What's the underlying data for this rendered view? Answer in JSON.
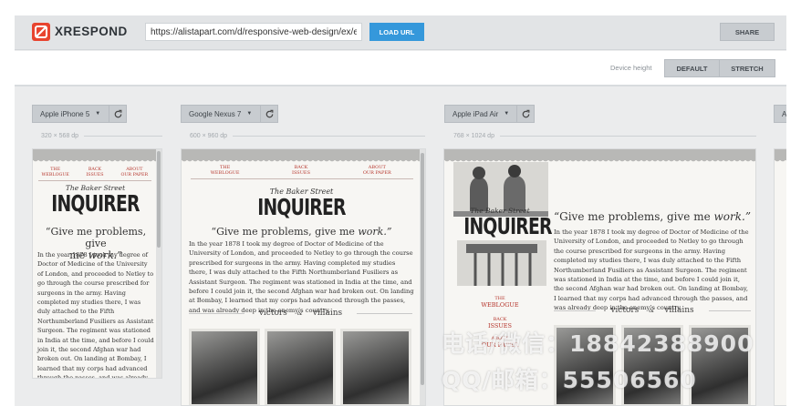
{
  "app": {
    "name": "XRESPOND",
    "url_value": "https://alistapart.com/d/responsive-web-design/ex/ex-site-flexible.html",
    "load_label": "LOAD URL",
    "share_label": "SHARE",
    "device_height_label": "Device height",
    "default_label": "DEFAULT",
    "stretch_label": "STRETCH"
  },
  "devices": [
    {
      "name": "Apple iPhone 5",
      "dims": "320 × 568 dp"
    },
    {
      "name": "Google Nexus 7",
      "dims": "600 × 960 dp"
    },
    {
      "name": "Apple iPad Air",
      "dims": "768 × 1024 dp"
    },
    {
      "name": "A"
    }
  ],
  "site": {
    "nav": [
      {
        "l1": "THE",
        "l2": "WEBLOGUE"
      },
      {
        "l1": "BACK",
        "l2": "ISSUES"
      },
      {
        "l1": "ABOUT",
        "l2": "OUR PAPER"
      }
    ],
    "masthead_top": "The Baker Street",
    "masthead": "INQUIRER",
    "quote_a": "“Give me problems, give",
    "quote_b": "me",
    "quote_c": "work.”",
    "quote_wide_a": "“Give me problems, give me",
    "quote_wide_b": "work.”",
    "body": "In the year 1878 I took my degree of Doctor of Medicine of the University of London, and proceeded to Netley to go through the course prescribed for surgeons in the army. Having completed my studies there, I was duly attached to the Fifth Northumberland Fusiliers as Assistant Surgeon. The regiment was stationed in India at the time, and before I could join it, the second Afghan war had broken out. On landing at Bombay, I learned that my corps had advanced through the passes, and was already deep in the enemy’s country.",
    "victors_a": "victors",
    "victors_amp": "&",
    "victors_b": "villains"
  },
  "watermark": {
    "line1": "电话/微信：18842388900",
    "line2": "QQ/邮箱：55506560"
  }
}
